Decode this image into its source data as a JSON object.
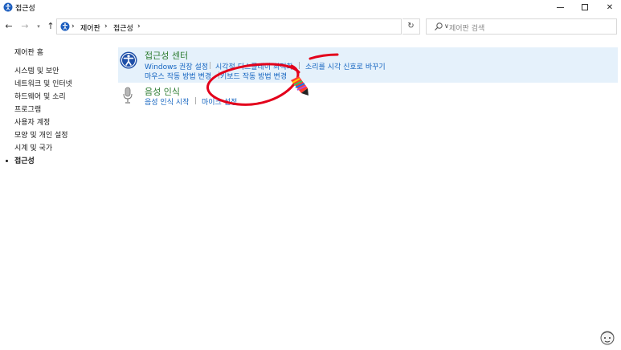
{
  "window": {
    "title": "접근성",
    "min_label": "",
    "max_label": "",
    "close_label": "✕"
  },
  "address": {
    "crumbs": [
      "제어판",
      "접근성"
    ],
    "separator": "›",
    "search_placeholder": "제어판 검색"
  },
  "leftnav": {
    "home": "제어판 홈",
    "items": [
      "시스템 및 보안",
      "네트워크 및 인터넷",
      "하드웨어 및 소리",
      "프로그램",
      "사용자 계정",
      "모양 및 개인 설정",
      "시계 및 국가",
      "접근성"
    ],
    "active_index": 7
  },
  "categories": [
    {
      "title": "접근성 센터",
      "icon": "accessibility-icon",
      "links_row1": [
        "Windows 권장 설정",
        "시각적 디스플레이 최적화",
        "소리를 시각 신호로 바꾸기"
      ],
      "links_row2": [
        "마우스 작동 방법 변경",
        "키보드 작동 방법 변경"
      ]
    },
    {
      "title": "음성 인식",
      "icon": "microphone-icon",
      "links_row1": [
        "음성 인식 시작",
        "마이크 설정"
      ]
    }
  ],
  "colors": {
    "category_title": "#2e7d32",
    "link": "#1565c0",
    "highlight_bg": "#e5f1fb",
    "annotation": "#e3001b"
  }
}
